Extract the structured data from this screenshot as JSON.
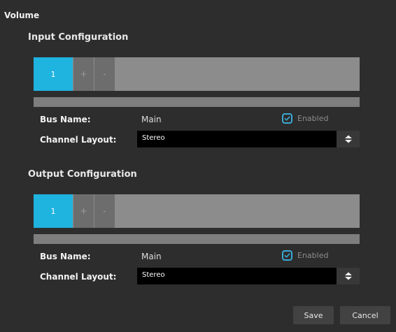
{
  "title": "Volume",
  "input": {
    "section_title": "Input Configuration",
    "tab_active": "1",
    "add_label": "+",
    "remove_label": "-",
    "bus_name_label": "Bus Name:",
    "bus_name_value": "Main",
    "enabled_label": "Enabled",
    "enabled_checked": true,
    "channel_layout_label": "Channel Layout:",
    "channel_layout_value": "Stereo"
  },
  "output": {
    "section_title": "Output Configuration",
    "tab_active": "1",
    "add_label": "+",
    "remove_label": "-",
    "bus_name_label": "Bus Name:",
    "bus_name_value": "Main",
    "enabled_label": "Enabled",
    "enabled_checked": true,
    "channel_layout_label": "Channel Layout:",
    "channel_layout_value": "Stereo"
  },
  "actions": {
    "save_label": "Save",
    "cancel_label": "Cancel"
  },
  "colors": {
    "background": "#2d2d2d",
    "accent": "#1fb3e0",
    "tab_bar": "#8c8c8c",
    "select_bg": "#000000"
  },
  "icons": {
    "checkbox": "checkmark-icon",
    "select_arrow": "up-down-arrows-icon"
  }
}
